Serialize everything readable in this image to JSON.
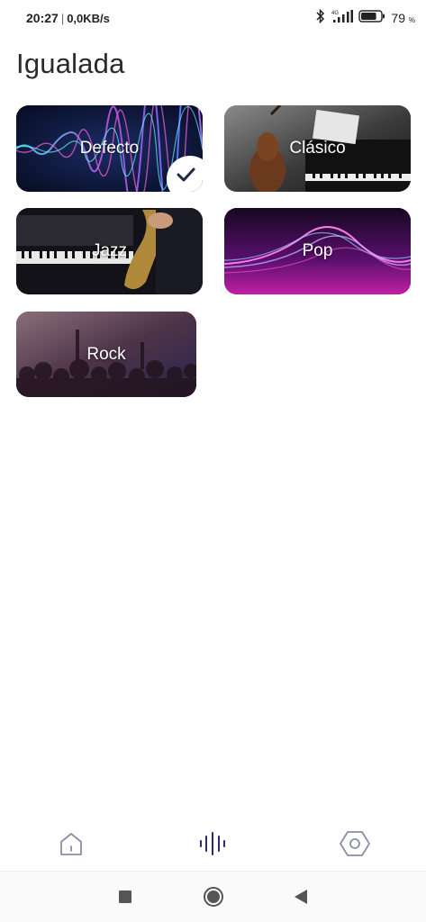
{
  "status_bar": {
    "time": "20:27",
    "separator": "|",
    "speed": "0,0KB/s",
    "network": "4G",
    "battery_percent": "79",
    "battery_unit": "%",
    "battery_level": 0.79
  },
  "page": {
    "title": "Igualada"
  },
  "presets": [
    {
      "label": "Defecto",
      "selected": true
    },
    {
      "label": "Clásico",
      "selected": false
    },
    {
      "label": "Jazz",
      "selected": false
    },
    {
      "label": "Pop",
      "selected": false
    },
    {
      "label": "Rock",
      "selected": false
    }
  ],
  "bottom_nav": {
    "items": [
      {
        "icon": "home-icon",
        "active": false
      },
      {
        "icon": "equalizer-icon",
        "active": true
      },
      {
        "icon": "settings-icon",
        "active": false
      }
    ]
  },
  "system_nav": {
    "icons": [
      "recent-apps-icon",
      "home-circle-icon",
      "back-icon"
    ]
  },
  "colors": {
    "accent": "#2c2a6b",
    "nav_inactive": "#8a8fa8",
    "title": "#2a2a2a"
  }
}
